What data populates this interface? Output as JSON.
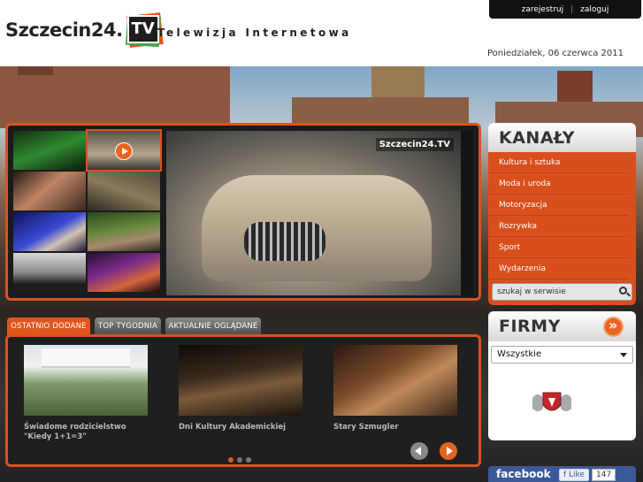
{
  "header": {
    "logo_text": "Szczecin24.",
    "logo_tv": "TV",
    "tagline": "Telewizja Internetowa",
    "date": "Poniedziałek, 06 czerwca 2011",
    "auth": {
      "register": "zarejestruj",
      "separator": "|",
      "login": "zaloguj"
    }
  },
  "player": {
    "watermark": "Szczecin24.TV",
    "thumbnail_count": 8,
    "selected_thumbnail": 2
  },
  "channels": {
    "title": "KANAŁY",
    "items": [
      "Kultura i sztuka",
      "Moda i uroda",
      "Motoryzacja",
      "Rozrywka",
      "Sport",
      "Wydarzenia"
    ],
    "search_placeholder": "szukaj w serwisie"
  },
  "firms": {
    "title": "FIRMY",
    "select_value": "Wszystkie"
  },
  "facebook": {
    "label": "facebook",
    "like": "Like",
    "count": "147"
  },
  "tabs": [
    "OSTATNIO DODANE",
    "TOP TYGODNIA",
    "AKTUALNIE OGLĄDANE"
  ],
  "recent": {
    "items": [
      {
        "caption": "Świadome rodzicielstwo \"Kiedy 1+1=3\""
      },
      {
        "caption": "Dni Kultury Akademickiej"
      },
      {
        "caption": "Stary Szmugler"
      }
    ],
    "pages": 3,
    "current_page": 1
  },
  "colors": {
    "accent": "#d9531e",
    "header_bg": "#ffffff",
    "facebook": "#3b5998"
  }
}
